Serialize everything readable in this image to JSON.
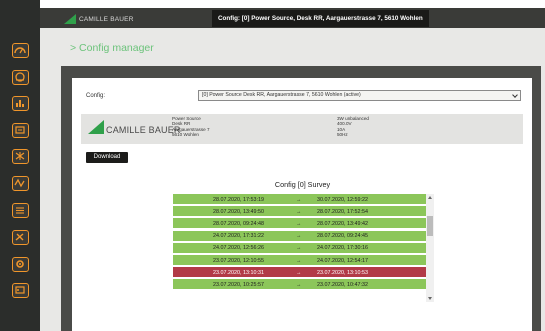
{
  "header": {
    "brand": "CAMILLE BAUER",
    "config_title": "Config: [0] Power Source, Desk RR, Aargauerstrasse 7, 5610 Wohlen"
  },
  "sidebar": {
    "icons": [
      "gauge-icon",
      "dial-icon",
      "bar-chart-icon",
      "panel-icon",
      "grid-icon",
      "waveform-icon",
      "list-icon",
      "tools-icon",
      "gear-icon",
      "settings-icon"
    ]
  },
  "main": {
    "page_title": "> Config manager",
    "config_label": "Config:",
    "config_select": "[0] Power Source Desk RR, Aargauerstrasse 7, 5610 Wohlen (active)",
    "info": {
      "brand": "CAMILLE BAUER",
      "location_lines": [
        "Power Source",
        "Desk RR",
        "Aargauerstrasse 7",
        "5610 Wohlen"
      ],
      "spec_lines": [
        "3W unbalanced",
        "400.0V",
        "10A",
        "50Hz"
      ]
    },
    "download_label": "Download",
    "survey_title": "Config [0] Survey",
    "survey_rows": [
      {
        "start": "28.07.2020, 17:53:19",
        "arrow": "→",
        "end": "30.07.2020, 12:59:22",
        "selected": false
      },
      {
        "start": "28.07.2020, 13:49:50",
        "arrow": "→",
        "end": "28.07.2020, 17:52:54",
        "selected": false
      },
      {
        "start": "28.07.2020, 09:24:48",
        "arrow": "→",
        "end": "28.07.2020, 13:49:42",
        "selected": false
      },
      {
        "start": "24.07.2020, 17:31:22",
        "arrow": "→",
        "end": "28.07.2020, 09:24:45",
        "selected": false
      },
      {
        "start": "24.07.2020, 12:56:26",
        "arrow": "→",
        "end": "24.07.2020, 17:30:16",
        "selected": false
      },
      {
        "start": "23.07.2020, 12:10:55",
        "arrow": "→",
        "end": "24.07.2020, 12:54:17",
        "selected": false
      },
      {
        "start": "23.07.2020, 13:10:31",
        "arrow": "→",
        "end": "23.07.2020, 13:10:53",
        "selected": true
      },
      {
        "start": "23.07.2020, 10:25:57",
        "arrow": "→",
        "end": "23.07.2020, 10:47:32",
        "selected": false
      }
    ]
  },
  "colors": {
    "accent_orange": "#f0962b",
    "row_green": "#8cc65a",
    "row_selected": "#b23a47",
    "title_green": "#6cc37b",
    "logo_green": "#2fa04a"
  }
}
